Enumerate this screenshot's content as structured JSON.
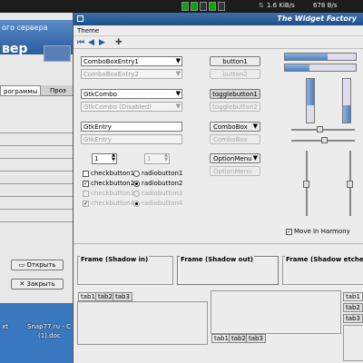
{
  "top_panel": {
    "net_down": "1.6 KiB/s",
    "net_up": "678 B/s"
  },
  "background_window": {
    "title_fragment": "ого сервера",
    "big_text": "вер",
    "tabs": [
      "рограммы",
      "Проэ"
    ],
    "open_button": "Открыть",
    "close_button": "Закрыть"
  },
  "desktop": {
    "icons": [
      "xt",
      "Snap77.ru - С",
      "(1).doc"
    ]
  },
  "widget_factory": {
    "title": "The Widget Factory",
    "menu": {
      "theme": "Theme"
    },
    "combos": {
      "entry1": "ComboBoxEntry1",
      "entry2": "ComboBoxEntry2",
      "gtkcombo": "GtkCombo",
      "gtkcombo_disabled": "GtkCombo (Disabled)",
      "gtkentry": "GtkEntry",
      "gtkentry_disabled": "GtkEntry",
      "spin1": "1",
      "spin2": "1"
    },
    "buttons": {
      "button1": "button1",
      "button2": "button2",
      "toggle1": "togglebutton1",
      "toggle2": "togglebutton2",
      "combobox": "ComboBox",
      "combobox_disabled": "ComboBox",
      "optionmenu": "OptionMenu",
      "optionmenu_disabled": "OptionMenu"
    },
    "checks": [
      "checkbutton1",
      "checkbutton2",
      "checkbutton3",
      "checkbutton4"
    ],
    "radios": [
      "radiobutton1",
      "radiobutton2",
      "radiobutton3",
      "radiobutton4"
    ],
    "harmony": "Move In Harmony",
    "frames": {
      "in": "Frame (Shadow in)",
      "out": "Frame (Shadow out)",
      "etched": "Frame (Shadow etched"
    },
    "tabs_a": [
      "tab1",
      "tab2",
      "tab3"
    ],
    "tabs_b": [
      "tab1",
      "tab2",
      "tab3"
    ],
    "tabs_c": [
      "tab1",
      "tab2",
      "tab3"
    ],
    "progress": {
      "h1": 0.6,
      "h2": 0.35,
      "v1": 0.6,
      "v2": 0.4
    }
  }
}
